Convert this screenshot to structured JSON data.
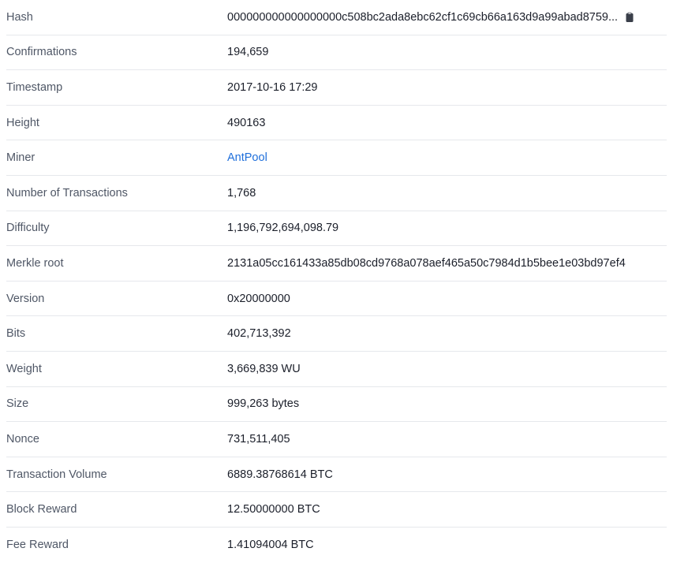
{
  "block": {
    "hash": {
      "label": "Hash",
      "value": "000000000000000000c508bc2ada8ebc62cf1c69cb66a163d9a99abad8759...",
      "copy_icon": "clipboard-icon"
    },
    "confirmations": {
      "label": "Confirmations",
      "value": "194,659"
    },
    "timestamp": {
      "label": "Timestamp",
      "value": "2017-10-16 17:29"
    },
    "height": {
      "label": "Height",
      "value": "490163"
    },
    "miner": {
      "label": "Miner",
      "value": "AntPool"
    },
    "num_transactions": {
      "label": "Number of Transactions",
      "value": "1,768"
    },
    "difficulty": {
      "label": "Difficulty",
      "value": "1,196,792,694,098.79"
    },
    "merkle_root": {
      "label": "Merkle root",
      "value": "2131a05cc161433a85db08cd9768a078aef465a50c7984d1b5bee1e03bd97ef4"
    },
    "version": {
      "label": "Version",
      "value": "0x20000000"
    },
    "bits": {
      "label": "Bits",
      "value": "402,713,392"
    },
    "weight": {
      "label": "Weight",
      "value": "3,669,839 WU"
    },
    "size": {
      "label": "Size",
      "value": "999,263 bytes"
    },
    "nonce": {
      "label": "Nonce",
      "value": "731,511,405"
    },
    "transaction_volume": {
      "label": "Transaction Volume",
      "value": "6889.38768614 BTC"
    },
    "block_reward": {
      "label": "Block Reward",
      "value": "12.50000000 BTC"
    },
    "fee_reward": {
      "label": "Fee Reward",
      "value": "1.41094004 BTC"
    }
  },
  "colors": {
    "link": "#1f6fdb",
    "label": "#4f5766",
    "divider": "#e6e8ec"
  }
}
